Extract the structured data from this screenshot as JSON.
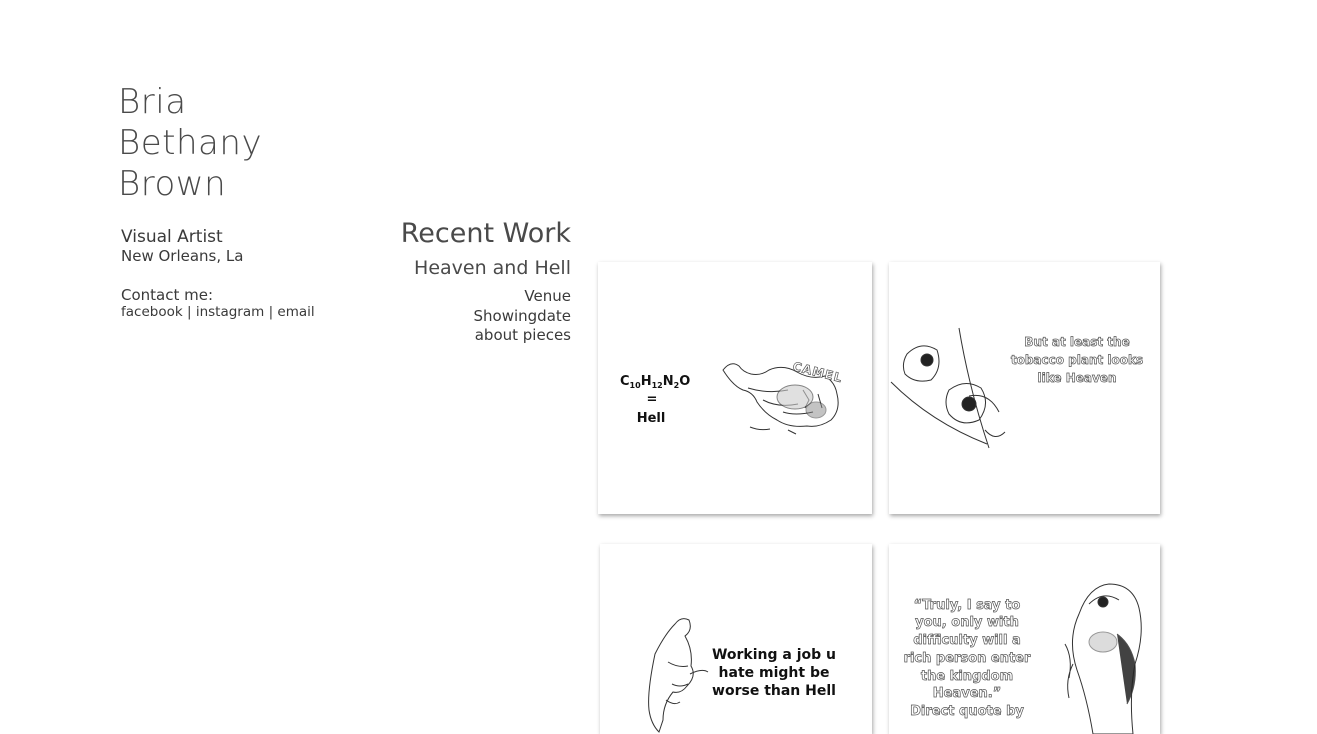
{
  "artist": {
    "name_lines": [
      "Bria",
      "Bethany",
      "Brown"
    ],
    "role": "Visual Artist",
    "location": "New Orleans, La"
  },
  "contact": {
    "title": "Contact me:",
    "links": [
      "facebook",
      "instagram",
      "email"
    ],
    "separator": "|"
  },
  "recent_work": {
    "heading": "Recent Work",
    "series_title": "Heaven and Hell",
    "sub_links": [
      "Venue",
      "Showingdate",
      "about pieces"
    ]
  },
  "artworks": [
    {
      "formula": [
        "C",
        "10",
        "H",
        "12",
        "N",
        "2",
        "O"
      ],
      "equals": "=",
      "word": "Hell",
      "brand": "CAMEL"
    },
    {
      "caption_lines": [
        "But at least the",
        "tobacco plant looks",
        "like Heaven"
      ]
    },
    {
      "caption_lines": [
        "Working a job u",
        "hate might be",
        "worse than Hell"
      ]
    },
    {
      "caption_lines": [
        "“Truly, I say to",
        "you, only with",
        "difficulty will a",
        "rich person enter",
        "the kingdom",
        "Heaven.”",
        "Direct quote by"
      ]
    }
  ]
}
